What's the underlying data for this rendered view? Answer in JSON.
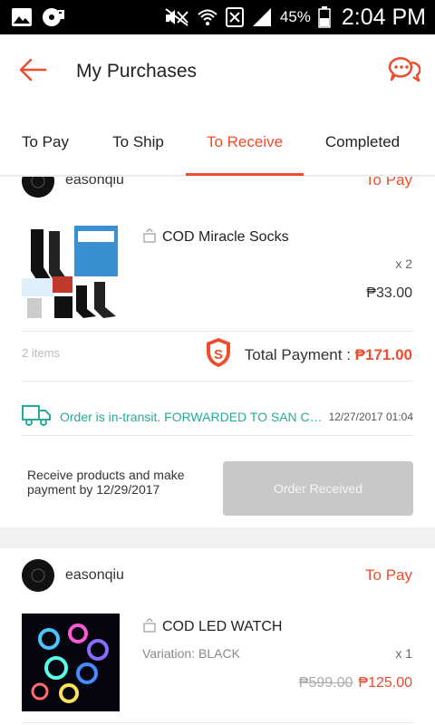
{
  "status_bar": {
    "battery": "45%",
    "time": "2:04 PM",
    "icons": [
      "image-icon",
      "music-record-icon",
      "mute-icon",
      "wifi-icon",
      "sim-icon",
      "signal-icon",
      "battery-icon"
    ]
  },
  "header": {
    "title": "My Purchases",
    "back_icon": "arrow-left-icon",
    "chat_icon": "chat-bubbles-icon"
  },
  "tabs": [
    {
      "label": "To Pay",
      "active": false
    },
    {
      "label": "To Ship",
      "active": false
    },
    {
      "label": "To Receive",
      "active": true
    },
    {
      "label": "Completed",
      "active": false
    }
  ],
  "orders": [
    {
      "shop_name": "easonqiu",
      "status": "To Pay",
      "item": {
        "title": "COD Miracle Socks",
        "quantity": "x 2",
        "price": "₱33.00"
      },
      "items_count": "2 items",
      "total_label": "Total Payment : ",
      "total_value": "₱171.00",
      "transit_text": "Order is in-transit. FORWARDED TO SAN CARL...",
      "transit_time": "12/27/2017 01:04",
      "receive_note": "Receive products and make payment by 12/29/2017",
      "button_label": "Order Received"
    },
    {
      "shop_name": "easonqiu",
      "status": "To Pay",
      "item": {
        "title": "COD LED WATCH",
        "variation": "Variation: BLACK",
        "quantity": "x 1",
        "original_price": "₱599.00",
        "price": "₱125.00"
      }
    }
  ],
  "colors": {
    "accent": "#ee4d2d",
    "teal": "#26aa99",
    "disabled_button": "#c8c8c8"
  }
}
